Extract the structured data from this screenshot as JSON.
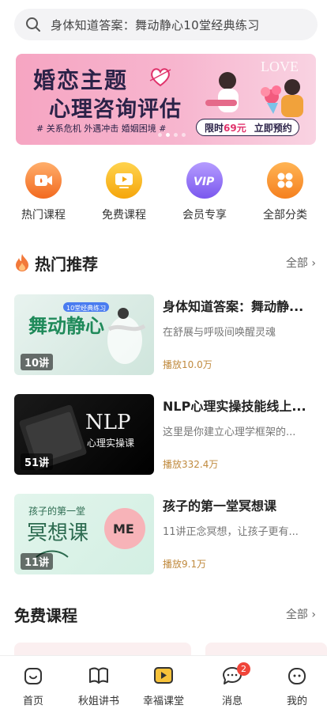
{
  "search": {
    "placeholder": "身体知道答案：舞动静心10堂经典练习"
  },
  "banner": {
    "title_line1": "婚恋主题",
    "title_line2": "心理咨询评估",
    "tags": "# 关系危机 外遇冲击 婚姻困境 #",
    "price_prefix": "限时",
    "price": "69元",
    "cta": "立即预约",
    "art_text": "LOVE",
    "slide_count": 4,
    "active_slide": 2
  },
  "categories": [
    {
      "label": "热门课程",
      "icon": "video-icon",
      "color": "#f47a2a"
    },
    {
      "label": "免费课程",
      "icon": "play-screen-icon",
      "color": "#f6b21a"
    },
    {
      "label": "会员专享",
      "icon": "vip-icon",
      "color": "#8b6cf0"
    },
    {
      "label": "全部分类",
      "icon": "grid-icon",
      "color": "#f6912c"
    }
  ],
  "hot": {
    "title": "热门推荐",
    "more": "全部",
    "courses": [
      {
        "title": "身体知道答案：舞动静...",
        "subtitle": "在舒展与呼吸间唤醒灵魂",
        "plays": "播放10.0万",
        "count": "10讲",
        "thumb_text": "舞动静心",
        "thumb_badge": "10堂经典练习"
      },
      {
        "title": "NLP心理实操技能线上...",
        "subtitle": "这里是你建立心理学框架的...",
        "plays": "播放332.4万",
        "count": "51讲",
        "thumb_text": "NLP",
        "thumb_sub": "心理实操课"
      },
      {
        "title": "孩子的第一堂冥想课",
        "subtitle": "11讲正念冥想，让孩子更有...",
        "plays": "播放9.1万",
        "count": "11讲",
        "thumb_text": "冥想课",
        "thumb_head": "孩子的第一堂"
      }
    ]
  },
  "free": {
    "title": "免费课程",
    "more": "全部"
  },
  "tabs": [
    {
      "label": "首页",
      "icon": "home-icon"
    },
    {
      "label": "秋姐讲书",
      "icon": "book-icon"
    },
    {
      "label": "幸福课堂",
      "icon": "class-play-icon"
    },
    {
      "label": "消息",
      "icon": "message-icon",
      "badge": "2"
    },
    {
      "label": "我的",
      "icon": "profile-icon"
    }
  ]
}
